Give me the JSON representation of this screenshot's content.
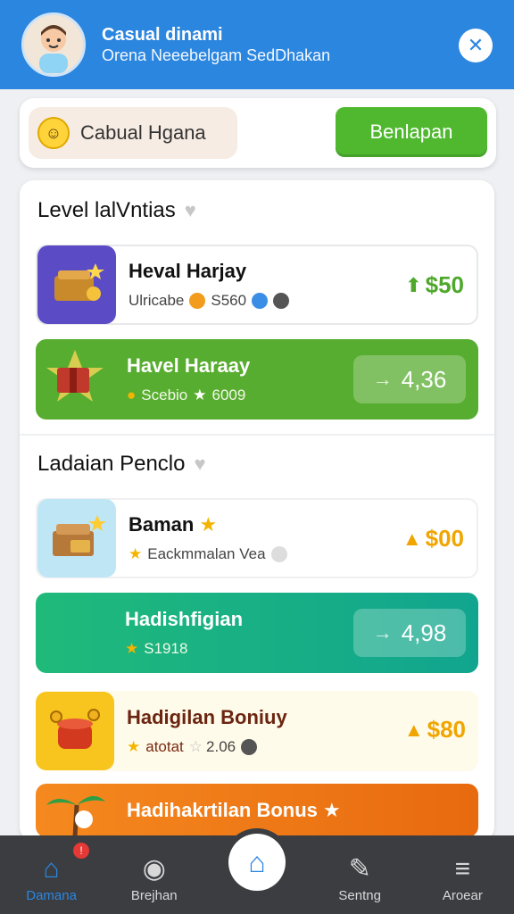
{
  "header": {
    "title": "Casual dinami",
    "subtitle": "Orena Neeebelgam SedDhakan",
    "close_icon": "close-icon"
  },
  "top_card": {
    "pill_label": "Cabual Hgana",
    "button_label": "Benlapan"
  },
  "sections": [
    {
      "title": "Level lalVntias",
      "items": [
        {
          "title": "Heval Harjay",
          "subtitle": "Ulricabe",
          "meta": "S560",
          "price": "$50"
        },
        {
          "title": "Havel Haraay",
          "subtitle": "Scebio",
          "meta": "6009",
          "amount": "4,36"
        }
      ]
    },
    {
      "title": "Ladaian Penclo",
      "items": [
        {
          "title": "Baman",
          "subtitle": "Eackmmalan Vea",
          "price": "$00"
        },
        {
          "title": "Hadishfigian",
          "subtitle": "S1918",
          "amount": "4,98"
        },
        {
          "title": "Hadigilan Boniuy",
          "subtitle": "atotat",
          "meta": "2.06",
          "price": "$80"
        },
        {
          "title": "Hadihakrtilan Bonus"
        }
      ]
    }
  ],
  "nav": {
    "items": [
      {
        "label": "Damana",
        "icon": "home-icon"
      },
      {
        "label": "Brejhan",
        "icon": "shield-icon"
      },
      {
        "label": "",
        "icon": "home-icon"
      },
      {
        "label": "Sentng",
        "icon": "chat-icon"
      },
      {
        "label": "Aroear",
        "icon": "menu-icon"
      }
    ],
    "badge": "!"
  },
  "colors": {
    "header_bg": "#2b86e0",
    "accent_green": "#4fb82f",
    "teal": "#1fba7a",
    "gold": "#f0a500"
  }
}
